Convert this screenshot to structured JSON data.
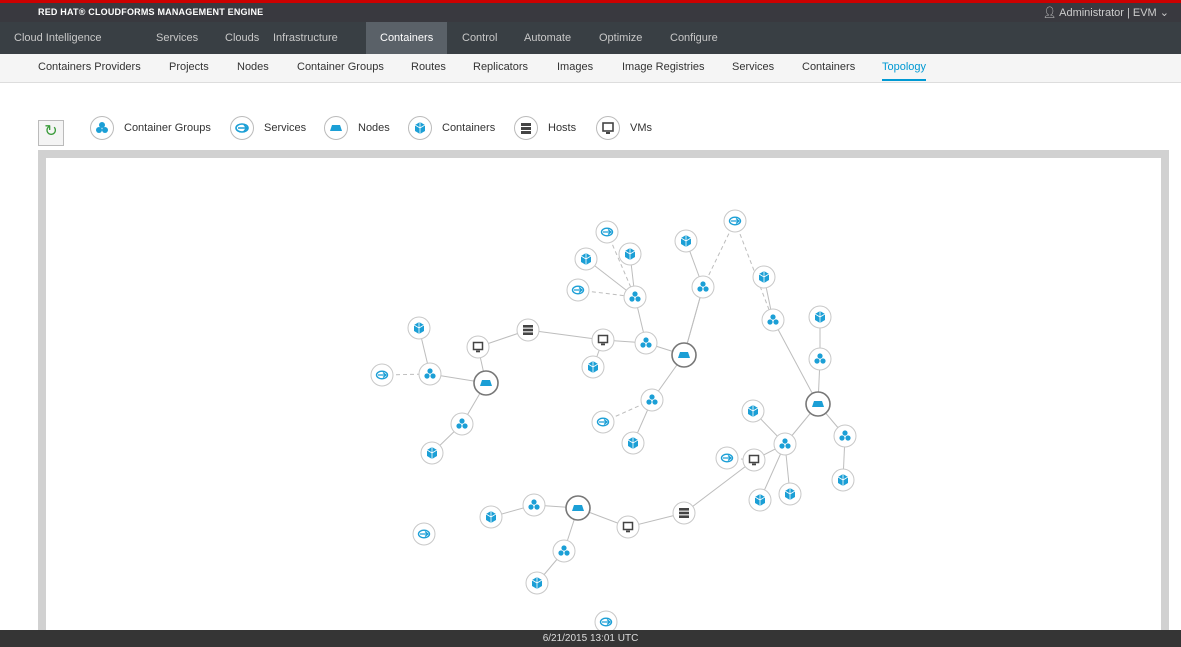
{
  "brand": {
    "title": "RED HAT® CLOUDFORMS MANAGEMENT ENGINE"
  },
  "user": {
    "label": "Administrator | EVM",
    "icon": "user-icon",
    "caret": "chevron-down-icon"
  },
  "main_nav": {
    "items": [
      "Cloud Intelligence",
      "Services",
      "Clouds",
      "Infrastructure",
      "Containers",
      "Control",
      "Automate",
      "Optimize",
      "Configure"
    ],
    "active": "Containers"
  },
  "sub_nav": {
    "items": [
      "Containers Providers",
      "Projects",
      "Nodes",
      "Container Groups",
      "Routes",
      "Replicators",
      "Images",
      "Image Registries",
      "Services",
      "Containers",
      "Topology"
    ],
    "active": "Topology"
  },
  "legend": {
    "refresh_icon": "refresh-icon",
    "items": [
      {
        "label": "Container Groups",
        "icon": "container-group-icon"
      },
      {
        "label": "Services",
        "icon": "service-icon"
      },
      {
        "label": "Nodes",
        "icon": "node-icon"
      },
      {
        "label": "Containers",
        "icon": "container-icon"
      },
      {
        "label": "Hosts",
        "icon": "host-icon"
      },
      {
        "label": "VMs",
        "icon": "vm-icon"
      }
    ]
  },
  "colors": {
    "accent": "#0099d3",
    "brand_red": "#cc0000",
    "nav_bg": "#393f44",
    "active_nav": "#5a6168",
    "node_icon": "#1b9fd6",
    "host_vm_icon": "#444444"
  },
  "status": {
    "timestamp": "6/21/2015 13:01 UTC"
  }
}
